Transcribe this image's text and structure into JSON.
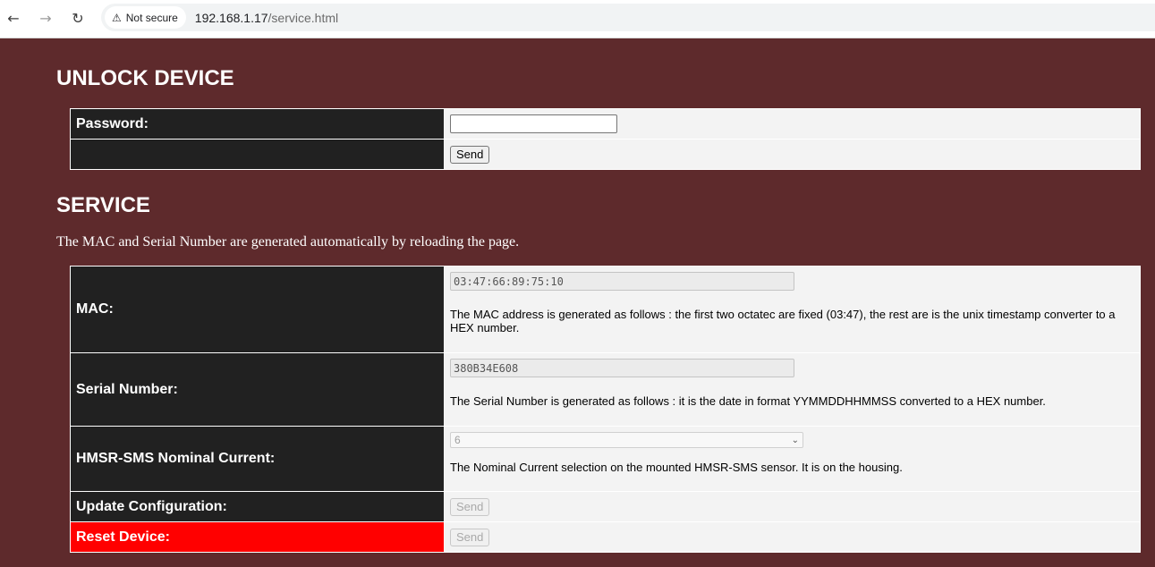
{
  "browser": {
    "security_label": "Not secure",
    "url_host": "192.168.1.17",
    "url_path": "/service.html"
  },
  "unlock": {
    "heading": "UNLOCK DEVICE",
    "password_label": "Password:",
    "password_value": "",
    "send_label": "Send"
  },
  "service": {
    "heading": "SERVICE",
    "description": "The MAC and Serial Number are generated automatically by reloading the page.",
    "mac_label": "MAC:",
    "mac_value": "03:47:66:89:75:10",
    "mac_help": "The MAC address is generated as follows : the first two octatec are fixed (03:47), the rest are is the unix timestamp converter to a HEX number.",
    "serial_label": "Serial Number:",
    "serial_value": "380B34E608",
    "serial_help": "The Serial Number is generated as follows : it is the date in format YYMMDDHHMMSS converted to a HEX number.",
    "current_label": "HMSR-SMS Nominal Current:",
    "current_value": "6",
    "current_help": "The Nominal Current selection on the mounted HMSR-SMS sensor. It is on the housing.",
    "update_label": "Update Configuration:",
    "update_send": "Send",
    "reset_label": "Reset Device:",
    "reset_send": "Send"
  },
  "colors": {
    "page_background": "#5e2a2c",
    "label_cell": "#212121",
    "reset_label_cell": "#ff0000",
    "value_cell": "#f3f3f3"
  },
  "icons": [
    "back-arrow-icon",
    "forward-arrow-icon",
    "reload-icon",
    "warning-icon",
    "chevron-down-icon"
  ]
}
